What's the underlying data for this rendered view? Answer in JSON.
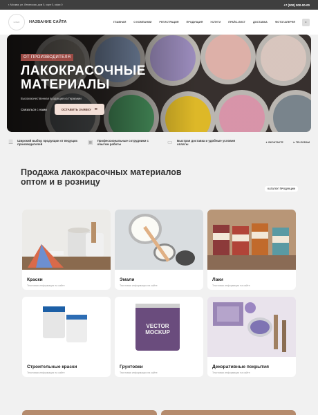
{
  "topbar": {
    "address": "г. Москва, ул. Ленинская, дом 0, корп 0, офис 0",
    "phone": "+7 (000) 000-00-00"
  },
  "header": {
    "site_name": "НАЗВАНИЕ САЙТА",
    "logo_text": "LOGO",
    "nav": [
      "ГЛАВНАЯ",
      "О КОМПАНИИ",
      "РЕГИСТРАЦИЯ",
      "ПРОДУКЦИЯ",
      "УСЛУГИ",
      "ПРАЙС-ЛИСТ",
      "ДОСТАВКА",
      "ФОТОГАЛЕРЕЯ"
    ]
  },
  "hero": {
    "label": "ОТ ПРОИЗВОДИТЕЛЯ",
    "title_line1": "ЛАКОКРАСОЧНЫЕ",
    "title_line2": "МАТЕРИАЛЫ",
    "subtitle": "Высококачественная продукция из Германии",
    "contact_link": "Связаться с нами",
    "cta": "ОСТАВИТЬ ЗАЯВКУ"
  },
  "features": [
    {
      "title": "Широкий выбор продукции от ведущих производителей"
    },
    {
      "title": "Профессиональные сотрудники с опытом работы"
    },
    {
      "title": "Быстрая доставка и удобные условия оплаты"
    }
  ],
  "socials": [
    "ВКОНТАКТЕ",
    "TELEGRAM"
  ],
  "section": {
    "title": "Продажа лакокрасочных материалов оптом и в розницу",
    "catalog_button": "КАТАЛОГ ПРОДУКЦИИ"
  },
  "products": [
    {
      "title": "Краски",
      "desc": "Текстовая информация на сайте"
    },
    {
      "title": "Эмали",
      "desc": "Текстовая информация на сайте"
    },
    {
      "title": "Лаки",
      "desc": "Текстовая информация на сайте"
    },
    {
      "title": "Строительные краски",
      "desc": "Текстовая информация на сайте"
    },
    {
      "title": "Грунтовки",
      "desc": "Текстовая информация на сайте"
    },
    {
      "title": "Декоративные покрытия",
      "desc": "Текстовая информация на сайте"
    }
  ],
  "mockup_text": [
    "VECTOR",
    "MOCKUP"
  ],
  "colors": {
    "accent": "#9b4a44",
    "cta_bg": "#f3e0d8",
    "topbar": "#3f3f3f",
    "page_bg": "#f1f1f1"
  }
}
